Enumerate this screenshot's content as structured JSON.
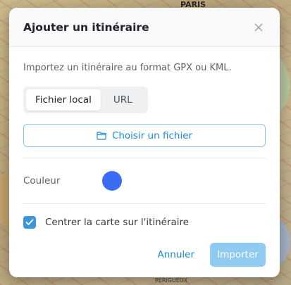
{
  "map": {
    "labels": [
      "PARIS",
      "PERIGUEUX"
    ]
  },
  "dialog": {
    "title": "Ajouter un itinéraire",
    "close_icon": "close-icon",
    "description": "Importez un itinéraire au format GPX ou KML.",
    "tabs": [
      {
        "label": "Fichier local",
        "active": true
      },
      {
        "label": "URL",
        "active": false
      }
    ],
    "file_button": {
      "icon": "folder-icon",
      "label": "Choisir un fichier"
    },
    "color": {
      "label": "Couleur",
      "value": "#3b6cf4"
    },
    "center_option": {
      "label": "Centrer la carte sur l'itinéraire",
      "checked": true
    },
    "footer": {
      "cancel_label": "Annuler",
      "import_label": "Importer"
    }
  },
  "colors": {
    "accent": "#1a8bd6",
    "import_disabled": "#8fcaf0",
    "checkbox": "#3a97d8"
  }
}
